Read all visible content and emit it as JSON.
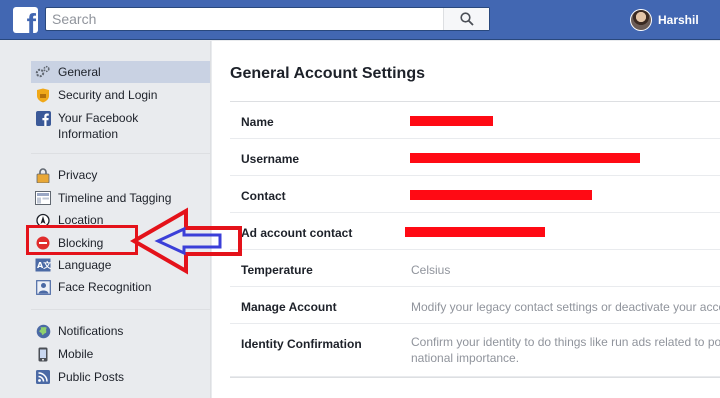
{
  "topbar": {
    "logo": "f",
    "search_placeholder": "Search",
    "user_name": "Harshil"
  },
  "sidebar": {
    "groups": [
      [
        {
          "label": "General",
          "icon": "gears-icon"
        },
        {
          "label": "Security and Login",
          "icon": "shield-icon"
        },
        {
          "label": "Your Facebook Information",
          "icon": "facebook-icon"
        }
      ],
      [
        {
          "label": "Privacy",
          "icon": "lock-icon"
        },
        {
          "label": "Timeline and Tagging",
          "icon": "timeline-icon"
        },
        {
          "label": "Location",
          "icon": "location-icon"
        },
        {
          "label": "Blocking",
          "icon": "blocking-icon"
        },
        {
          "label": "Language",
          "icon": "language-icon"
        },
        {
          "label": "Face Recognition",
          "icon": "face-recognition-icon"
        }
      ],
      [
        {
          "label": "Notifications",
          "icon": "globe-icon"
        },
        {
          "label": "Mobile",
          "icon": "mobile-icon"
        },
        {
          "label": "Public Posts",
          "icon": "rss-icon"
        }
      ]
    ]
  },
  "main": {
    "title": "General Account Settings",
    "rows": [
      {
        "key": "Name",
        "value": ""
      },
      {
        "key": "Username",
        "value": ""
      },
      {
        "key": "Contact",
        "value": ""
      },
      {
        "key": "Ad account contact",
        "value": ""
      },
      {
        "key": "Temperature",
        "value": "Celsius"
      },
      {
        "key": "Manage Account",
        "value": "Modify your legacy contact settings or deactivate your acco"
      },
      {
        "key": "Identity Confirmation",
        "value": "Confirm your identity to do things like run ads related to po national importance."
      }
    ]
  },
  "colors": {
    "brand": "#4267b2",
    "annotation_red": "#e4121a",
    "annotation_blue": "#3b3fd8",
    "active_item_bg": "#c9d2e3"
  }
}
